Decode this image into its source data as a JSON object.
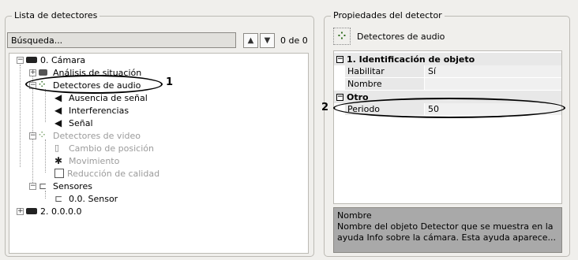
{
  "left_panel": {
    "title": "Lista de detectores",
    "search_placeholder": "Búsqueda...",
    "up_label": "▲",
    "down_label": "▼",
    "counter": "0 de 0",
    "tree": [
      {
        "label": "0. Cámara"
      },
      {
        "label": "Análisis de situación"
      },
      {
        "label": "Detectores de audio"
      },
      {
        "label": "Ausencia de señal"
      },
      {
        "label": "Interferencias"
      },
      {
        "label": "Señal"
      },
      {
        "label": "Detectores de video"
      },
      {
        "label": "Cambio de posición"
      },
      {
        "label": "Movimiento"
      },
      {
        "label": "Reducción de calidad"
      },
      {
        "label": "Sensores"
      },
      {
        "label": "0.0. Sensor"
      },
      {
        "label": "2. 0.0.0.0"
      }
    ]
  },
  "right_panel": {
    "title": "Propiedades del detector",
    "detector_name": "Detectores de audio",
    "categories": [
      {
        "label": "1. Identificación de objeto",
        "toggle": "−"
      },
      {
        "label": "Otro",
        "toggle": "−"
      }
    ],
    "properties": [
      {
        "name": "Habilitar",
        "value": "Sí"
      },
      {
        "name": "Nombre",
        "value": ""
      },
      {
        "name": "Periodo",
        "value": "50"
      }
    ],
    "help_title": "Nombre",
    "help_text": "Nombre del objeto Detector que se muestra en la ayuda Info sobre la cámara. Esta ayuda aparece..."
  },
  "callouts": [
    "1",
    "2"
  ]
}
